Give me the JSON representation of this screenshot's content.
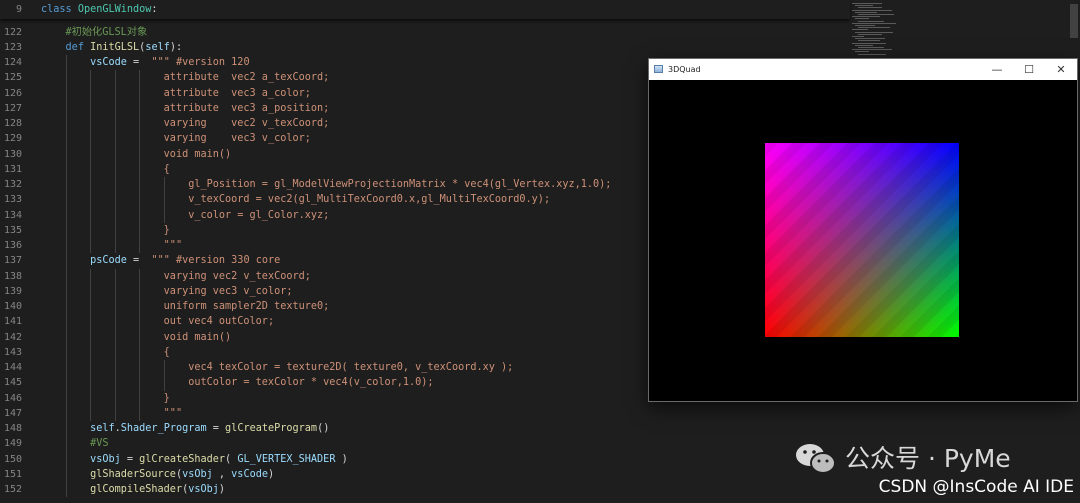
{
  "sticky": {
    "line_number": "9",
    "code": "class OpenGLWindow:"
  },
  "lines": [
    {
      "n": "122",
      "indent": "    ",
      "parts": [
        {
          "t": "#初始化GLSL对象",
          "c": "cmt"
        }
      ]
    },
    {
      "n": "123",
      "indent": "    ",
      "parts": [
        {
          "t": "def ",
          "c": "kw"
        },
        {
          "t": "InitGLSL",
          "c": "fn"
        },
        {
          "t": "(",
          "c": ""
        },
        {
          "t": "self",
          "c": "var"
        },
        {
          "t": "):",
          "c": ""
        }
      ]
    },
    {
      "n": "124",
      "indent": "        ",
      "parts": [
        {
          "t": "vsCode",
          "c": "var"
        },
        {
          "t": " =  ",
          "c": ""
        },
        {
          "t": "\"\"\" #version 120",
          "c": "str"
        }
      ]
    },
    {
      "n": "125",
      "indent": "                    ",
      "parts": [
        {
          "t": "attribute  vec2 a_texCoord;",
          "c": "str"
        }
      ]
    },
    {
      "n": "126",
      "indent": "                    ",
      "parts": [
        {
          "t": "attribute  vec3 a_color;",
          "c": "str"
        }
      ]
    },
    {
      "n": "127",
      "indent": "                    ",
      "parts": [
        {
          "t": "attribute  vec3 a_position;",
          "c": "str"
        }
      ]
    },
    {
      "n": "128",
      "indent": "                    ",
      "parts": [
        {
          "t": "varying    vec2 v_texCoord;",
          "c": "str"
        }
      ]
    },
    {
      "n": "129",
      "indent": "                    ",
      "parts": [
        {
          "t": "varying    vec3 v_color;",
          "c": "str"
        }
      ]
    },
    {
      "n": "130",
      "indent": "                    ",
      "parts": [
        {
          "t": "void main()",
          "c": "str"
        }
      ]
    },
    {
      "n": "131",
      "indent": "                    ",
      "parts": [
        {
          "t": "{",
          "c": "str"
        }
      ]
    },
    {
      "n": "132",
      "indent": "                        ",
      "parts": [
        {
          "t": "gl_Position = gl_ModelViewProjectionMatrix * vec4(gl_Vertex.xyz,1.0);",
          "c": "str"
        }
      ]
    },
    {
      "n": "133",
      "indent": "                        ",
      "parts": [
        {
          "t": "v_texCoord = vec2(gl_MultiTexCoord0.x,gl_MultiTexCoord0.y);",
          "c": "str"
        }
      ]
    },
    {
      "n": "134",
      "indent": "                        ",
      "parts": [
        {
          "t": "v_color = gl_Color.xyz;",
          "c": "str"
        }
      ]
    },
    {
      "n": "135",
      "indent": "                    ",
      "parts": [
        {
          "t": "}",
          "c": "str"
        }
      ]
    },
    {
      "n": "136",
      "indent": "                    ",
      "parts": [
        {
          "t": "\"\"\"",
          "c": "str"
        }
      ]
    },
    {
      "n": "137",
      "indent": "        ",
      "parts": [
        {
          "t": "psCode",
          "c": "var"
        },
        {
          "t": " =  ",
          "c": ""
        },
        {
          "t": "\"\"\" #version 330 core",
          "c": "str"
        }
      ]
    },
    {
      "n": "138",
      "indent": "                    ",
      "parts": [
        {
          "t": "varying vec2 v_texCoord;",
          "c": "str"
        }
      ]
    },
    {
      "n": "139",
      "indent": "                    ",
      "parts": [
        {
          "t": "varying vec3 v_color;",
          "c": "str"
        }
      ]
    },
    {
      "n": "140",
      "indent": "                    ",
      "parts": [
        {
          "t": "uniform sampler2D texture0;",
          "c": "str"
        }
      ]
    },
    {
      "n": "141",
      "indent": "                    ",
      "parts": [
        {
          "t": "out vec4 outColor;",
          "c": "str"
        }
      ]
    },
    {
      "n": "142",
      "indent": "                    ",
      "parts": [
        {
          "t": "void main()",
          "c": "str"
        }
      ]
    },
    {
      "n": "143",
      "indent": "                    ",
      "parts": [
        {
          "t": "{",
          "c": "str"
        }
      ]
    },
    {
      "n": "144",
      "indent": "                        ",
      "parts": [
        {
          "t": "vec4 texColor = texture2D( texture0, v_texCoord.xy );",
          "c": "str"
        }
      ]
    },
    {
      "n": "145",
      "indent": "                        ",
      "parts": [
        {
          "t": "outColor = texColor * vec4(v_color,1.0);",
          "c": "str"
        }
      ]
    },
    {
      "n": "146",
      "indent": "                    ",
      "parts": [
        {
          "t": "}",
          "c": "str"
        }
      ]
    },
    {
      "n": "147",
      "indent": "                    ",
      "parts": [
        {
          "t": "\"\"\"",
          "c": "str"
        }
      ]
    },
    {
      "n": "148",
      "indent": "        ",
      "parts": [
        {
          "t": "self",
          "c": "var"
        },
        {
          "t": ".",
          "c": ""
        },
        {
          "t": "Shader_Program",
          "c": "var"
        },
        {
          "t": " = ",
          "c": ""
        },
        {
          "t": "glCreateProgram",
          "c": "fn"
        },
        {
          "t": "()",
          "c": ""
        }
      ]
    },
    {
      "n": "149",
      "indent": "        ",
      "parts": [
        {
          "t": "#VS",
          "c": "cmt"
        }
      ]
    },
    {
      "n": "150",
      "indent": "        ",
      "parts": [
        {
          "t": "vsObj",
          "c": "var"
        },
        {
          "t": " = ",
          "c": ""
        },
        {
          "t": "glCreateShader",
          "c": "fn"
        },
        {
          "t": "( ",
          "c": ""
        },
        {
          "t": "GL_VERTEX_SHADER",
          "c": "var"
        },
        {
          "t": " )",
          "c": ""
        }
      ]
    },
    {
      "n": "151",
      "indent": "        ",
      "parts": [
        {
          "t": "glShaderSource",
          "c": "fn"
        },
        {
          "t": "(",
          "c": ""
        },
        {
          "t": "vsObj",
          "c": "var"
        },
        {
          "t": " , ",
          "c": ""
        },
        {
          "t": "vsCode",
          "c": "var"
        },
        {
          "t": ")",
          "c": ""
        }
      ]
    },
    {
      "n": "152",
      "indent": "        ",
      "parts": [
        {
          "t": "glCompileShader",
          "c": "fn"
        },
        {
          "t": "(",
          "c": ""
        },
        {
          "t": "vsObj",
          "c": "var"
        },
        {
          "t": ")",
          "c": ""
        }
      ]
    }
  ],
  "window": {
    "title": "3DQuad",
    "minimize_glyph": "—",
    "maximize_glyph": "☐",
    "close_glyph": "✕",
    "quad_colors": {
      "top_left": "#ff00ff",
      "top_right": "#0000ff",
      "bottom_left": "#ff0000",
      "bottom_right": "#00ff00"
    }
  },
  "watermark": {
    "text": "公众号 · PyMe"
  },
  "credit": {
    "text": "CSDN @InsCode AI IDE"
  },
  "colors": {
    "background": "#1e1e1e",
    "keyword": "#569cd6",
    "string": "#ce9178",
    "comment": "#6a9955",
    "function": "#dcdcaa"
  }
}
